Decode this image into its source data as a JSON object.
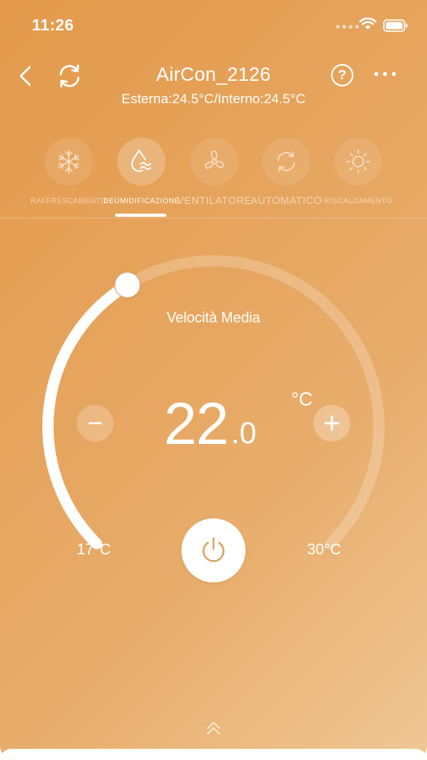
{
  "status_bar": {
    "time": "11:26",
    "icons": [
      "signal-dots",
      "wifi-icon",
      "battery-icon"
    ]
  },
  "header": {
    "title": "AirCon_2126",
    "subtitle": "Esterna:24.5°C/Interno:24.5°C",
    "help_label": "?",
    "icons": [
      "chevron-left-icon",
      "refresh-icon",
      "help-icon",
      "more-icon"
    ]
  },
  "modes": {
    "selected": "DEUMIDIFICAZIONE",
    "items": [
      {
        "label": "RAFFRESCAMENTO",
        "icon": "snowflake-icon"
      },
      {
        "label": "DEUMIDIFICAZIONE",
        "icon": "drop-icon"
      },
      {
        "label": "VENTILATORE",
        "icon": "fan-icon"
      },
      {
        "label": "AUTOMATICO",
        "icon": "auto-cycle-icon"
      },
      {
        "label": "RISCALDAMENTO",
        "icon": "sun-icon"
      }
    ]
  },
  "dial": {
    "fan_speed": "Velocità Media",
    "temperature_integer": "22",
    "temperature_decimal": ".0",
    "unit": "°C",
    "min_label": "17°C",
    "max_label": "30°C",
    "min_value": 17,
    "max_value": 30,
    "current_value": 22.0,
    "knob_fraction": 0.384
  },
  "colors": {
    "background_start": "#e39a4c",
    "background_end": "#efc795",
    "accent": "#ffffff",
    "power_icon": "#d9a564"
  }
}
